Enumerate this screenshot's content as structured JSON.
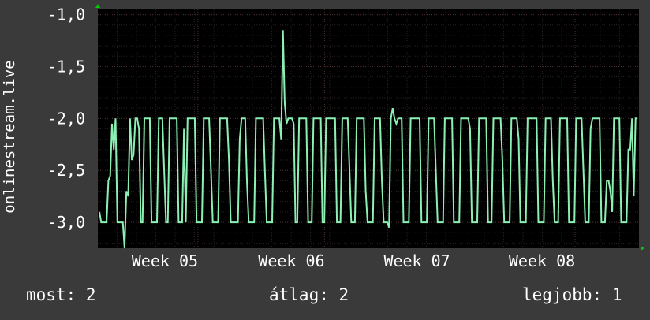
{
  "chart_data": {
    "type": "line",
    "ylabel": "onlinestream.live",
    "ylim": [
      -3.25,
      -0.95
    ],
    "y_ticks": [
      -1.0,
      -1.5,
      -2.0,
      -2.5,
      -3.0
    ],
    "y_tick_labels": [
      "-1,0",
      "-1,5",
      "-2,0",
      "-2,5",
      "-3,0"
    ],
    "x_tick_labels": [
      "Week 05",
      "Week 06",
      "Week 07",
      "Week 08"
    ],
    "x_tick_positions": [
      0.185,
      0.419,
      0.651,
      0.882
    ],
    "grid": true,
    "colors": {
      "background": "#3a3a3a",
      "plot": "#000000",
      "grid": "#4a2e2e",
      "line": "#8cf0b4",
      "axis_arrow": "#00cc00"
    },
    "series": [
      {
        "values": [
          -2.9,
          -3.0,
          -3.0,
          -3.0,
          -3.0,
          -2.6,
          -2.55,
          -2.05,
          -2.3,
          -2.0,
          -3.0,
          -3.0,
          -3.0,
          -3.0,
          -3.25,
          -2.7,
          -2.75,
          -2.0,
          -2.4,
          -2.35,
          -2.0,
          -2.0,
          -2.1,
          -3.0,
          -3.0,
          -2.0,
          -2.0,
          -2.0,
          -2.0,
          -3.0,
          -3.0,
          -3.0,
          -3.0,
          -2.0,
          -2.0,
          -2.0,
          -2.5,
          -3.0,
          -3.0,
          -2.0,
          -2.0,
          -2.0,
          -2.0,
          -2.0,
          -3.0,
          -3.0,
          -3.0,
          -2.1,
          -3.0,
          -2.0,
          -2.0,
          -2.0,
          -2.0,
          -2.0,
          -3.0,
          -3.0,
          -3.0,
          -3.0,
          -2.0,
          -2.0,
          -2.0,
          -2.0,
          -2.5,
          -3.0,
          -3.0,
          -3.0,
          -3.0,
          -2.0,
          -2.0,
          -2.0,
          -2.0,
          -2.0,
          -2.4,
          -3.0,
          -3.0,
          -3.0,
          -3.0,
          -3.0,
          -2.2,
          -2.0,
          -2.0,
          -2.0,
          -2.6,
          -3.0,
          -3.0,
          -3.0,
          -3.0,
          -2.0,
          -2.0,
          -2.0,
          -2.0,
          -2.0,
          -2.5,
          -3.0,
          -3.0,
          -3.0,
          -3.0,
          -2.0,
          -2.0,
          -2.0,
          -2.0,
          -2.2,
          -1.15,
          -1.85,
          -2.05,
          -2.0,
          -2.0,
          -2.0,
          -2.05,
          -3.0,
          -3.0,
          -2.0,
          -2.0,
          -2.0,
          -2.0,
          -2.0,
          -3.0,
          -3.0,
          -3.0,
          -2.0,
          -2.0,
          -2.0,
          -2.0,
          -2.0,
          -3.0,
          -3.0,
          -2.0,
          -2.0,
          -2.0,
          -2.0,
          -2.0,
          -2.0,
          -3.0,
          -3.0,
          -3.0,
          -2.0,
          -2.0,
          -2.0,
          -2.0,
          -2.5,
          -3.0,
          -3.0,
          -3.0,
          -2.0,
          -2.0,
          -2.0,
          -2.0,
          -2.0,
          -2.7,
          -3.0,
          -3.0,
          -3.0,
          -3.0,
          -2.0,
          -2.0,
          -2.0,
          -2.0,
          -2.6,
          -3.0,
          -3.0,
          -3.0,
          -3.05,
          -2.0,
          -1.9,
          -2.0,
          -2.05,
          -2.0,
          -2.0,
          -2.0,
          -3.0,
          -3.0,
          -3.0,
          -3.0,
          -2.0,
          -2.0,
          -2.0,
          -2.0,
          -2.0,
          -2.0,
          -3.0,
          -3.0,
          -3.0,
          -3.0,
          -2.0,
          -2.0,
          -2.0,
          -2.0,
          -2.5,
          -3.0,
          -3.0,
          -3.0,
          -3.0,
          -2.0,
          -2.0,
          -2.0,
          -2.0,
          -2.0,
          -3.0,
          -3.0,
          -3.0,
          -3.0,
          -2.0,
          -2.0,
          -2.0,
          -2.0,
          -2.0,
          -2.1,
          -3.0,
          -3.0,
          -3.0,
          -3.0,
          -2.0,
          -2.0,
          -2.0,
          -2.0,
          -2.0,
          -3.0,
          -3.0,
          -3.0,
          -2.0,
          -2.0,
          -2.0,
          -2.0,
          -2.0,
          -2.4,
          -3.0,
          -3.0,
          -3.0,
          -3.0,
          -2.0,
          -2.0,
          -2.0,
          -2.0,
          -2.2,
          -3.0,
          -3.0,
          -3.0,
          -3.0,
          -2.0,
          -2.0,
          -2.0,
          -2.0,
          -2.0,
          -2.0,
          -3.0,
          -3.0,
          -3.0,
          -3.0,
          -2.0,
          -2.0,
          -2.0,
          -2.0,
          -2.6,
          -3.0,
          -3.0,
          -3.0,
          -2.0,
          -2.0,
          -2.0,
          -2.0,
          -2.0,
          -3.0,
          -3.0,
          -3.0,
          -3.0,
          -2.0,
          -2.0,
          -2.0,
          -2.0,
          -2.5,
          -3.0,
          -3.0,
          -3.0,
          -2.1,
          -2.0,
          -2.0,
          -2.0,
          -2.0,
          -2.0,
          -3.0,
          -3.0,
          -3.0,
          -2.6,
          -2.6,
          -2.7,
          -2.9,
          -2.0,
          -2.0,
          -2.0,
          -2.0,
          -3.0,
          -3.0,
          -3.0,
          -3.0,
          -2.3,
          -2.3,
          -2.0,
          -2.75,
          -2.0,
          -2.0
        ]
      }
    ]
  },
  "footer": {
    "now_label": "most:",
    "now_value": "2",
    "avg_label": "átlag:",
    "avg_value": "2",
    "best_label": "legjobb:",
    "best_value": "1"
  }
}
